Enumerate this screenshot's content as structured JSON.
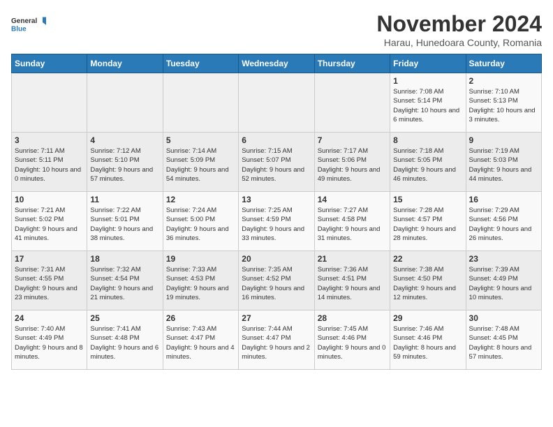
{
  "logo": {
    "general": "General",
    "blue": "Blue"
  },
  "title": "November 2024",
  "subtitle": "Harau, Hunedoara County, Romania",
  "days_of_week": [
    "Sunday",
    "Monday",
    "Tuesday",
    "Wednesday",
    "Thursday",
    "Friday",
    "Saturday"
  ],
  "weeks": [
    [
      {
        "day": "",
        "info": ""
      },
      {
        "day": "",
        "info": ""
      },
      {
        "day": "",
        "info": ""
      },
      {
        "day": "",
        "info": ""
      },
      {
        "day": "",
        "info": ""
      },
      {
        "day": "1",
        "info": "Sunrise: 7:08 AM\nSunset: 5:14 PM\nDaylight: 10 hours and 6 minutes."
      },
      {
        "day": "2",
        "info": "Sunrise: 7:10 AM\nSunset: 5:13 PM\nDaylight: 10 hours and 3 minutes."
      }
    ],
    [
      {
        "day": "3",
        "info": "Sunrise: 7:11 AM\nSunset: 5:11 PM\nDaylight: 10 hours and 0 minutes."
      },
      {
        "day": "4",
        "info": "Sunrise: 7:12 AM\nSunset: 5:10 PM\nDaylight: 9 hours and 57 minutes."
      },
      {
        "day": "5",
        "info": "Sunrise: 7:14 AM\nSunset: 5:09 PM\nDaylight: 9 hours and 54 minutes."
      },
      {
        "day": "6",
        "info": "Sunrise: 7:15 AM\nSunset: 5:07 PM\nDaylight: 9 hours and 52 minutes."
      },
      {
        "day": "7",
        "info": "Sunrise: 7:17 AM\nSunset: 5:06 PM\nDaylight: 9 hours and 49 minutes."
      },
      {
        "day": "8",
        "info": "Sunrise: 7:18 AM\nSunset: 5:05 PM\nDaylight: 9 hours and 46 minutes."
      },
      {
        "day": "9",
        "info": "Sunrise: 7:19 AM\nSunset: 5:03 PM\nDaylight: 9 hours and 44 minutes."
      }
    ],
    [
      {
        "day": "10",
        "info": "Sunrise: 7:21 AM\nSunset: 5:02 PM\nDaylight: 9 hours and 41 minutes."
      },
      {
        "day": "11",
        "info": "Sunrise: 7:22 AM\nSunset: 5:01 PM\nDaylight: 9 hours and 38 minutes."
      },
      {
        "day": "12",
        "info": "Sunrise: 7:24 AM\nSunset: 5:00 PM\nDaylight: 9 hours and 36 minutes."
      },
      {
        "day": "13",
        "info": "Sunrise: 7:25 AM\nSunset: 4:59 PM\nDaylight: 9 hours and 33 minutes."
      },
      {
        "day": "14",
        "info": "Sunrise: 7:27 AM\nSunset: 4:58 PM\nDaylight: 9 hours and 31 minutes."
      },
      {
        "day": "15",
        "info": "Sunrise: 7:28 AM\nSunset: 4:57 PM\nDaylight: 9 hours and 28 minutes."
      },
      {
        "day": "16",
        "info": "Sunrise: 7:29 AM\nSunset: 4:56 PM\nDaylight: 9 hours and 26 minutes."
      }
    ],
    [
      {
        "day": "17",
        "info": "Sunrise: 7:31 AM\nSunset: 4:55 PM\nDaylight: 9 hours and 23 minutes."
      },
      {
        "day": "18",
        "info": "Sunrise: 7:32 AM\nSunset: 4:54 PM\nDaylight: 9 hours and 21 minutes."
      },
      {
        "day": "19",
        "info": "Sunrise: 7:33 AM\nSunset: 4:53 PM\nDaylight: 9 hours and 19 minutes."
      },
      {
        "day": "20",
        "info": "Sunrise: 7:35 AM\nSunset: 4:52 PM\nDaylight: 9 hours and 16 minutes."
      },
      {
        "day": "21",
        "info": "Sunrise: 7:36 AM\nSunset: 4:51 PM\nDaylight: 9 hours and 14 minutes."
      },
      {
        "day": "22",
        "info": "Sunrise: 7:38 AM\nSunset: 4:50 PM\nDaylight: 9 hours and 12 minutes."
      },
      {
        "day": "23",
        "info": "Sunrise: 7:39 AM\nSunset: 4:49 PM\nDaylight: 9 hours and 10 minutes."
      }
    ],
    [
      {
        "day": "24",
        "info": "Sunrise: 7:40 AM\nSunset: 4:49 PM\nDaylight: 9 hours and 8 minutes."
      },
      {
        "day": "25",
        "info": "Sunrise: 7:41 AM\nSunset: 4:48 PM\nDaylight: 9 hours and 6 minutes."
      },
      {
        "day": "26",
        "info": "Sunrise: 7:43 AM\nSunset: 4:47 PM\nDaylight: 9 hours and 4 minutes."
      },
      {
        "day": "27",
        "info": "Sunrise: 7:44 AM\nSunset: 4:47 PM\nDaylight: 9 hours and 2 minutes."
      },
      {
        "day": "28",
        "info": "Sunrise: 7:45 AM\nSunset: 4:46 PM\nDaylight: 9 hours and 0 minutes."
      },
      {
        "day": "29",
        "info": "Sunrise: 7:46 AM\nSunset: 4:46 PM\nDaylight: 8 hours and 59 minutes."
      },
      {
        "day": "30",
        "info": "Sunrise: 7:48 AM\nSunset: 4:45 PM\nDaylight: 8 hours and 57 minutes."
      }
    ]
  ]
}
